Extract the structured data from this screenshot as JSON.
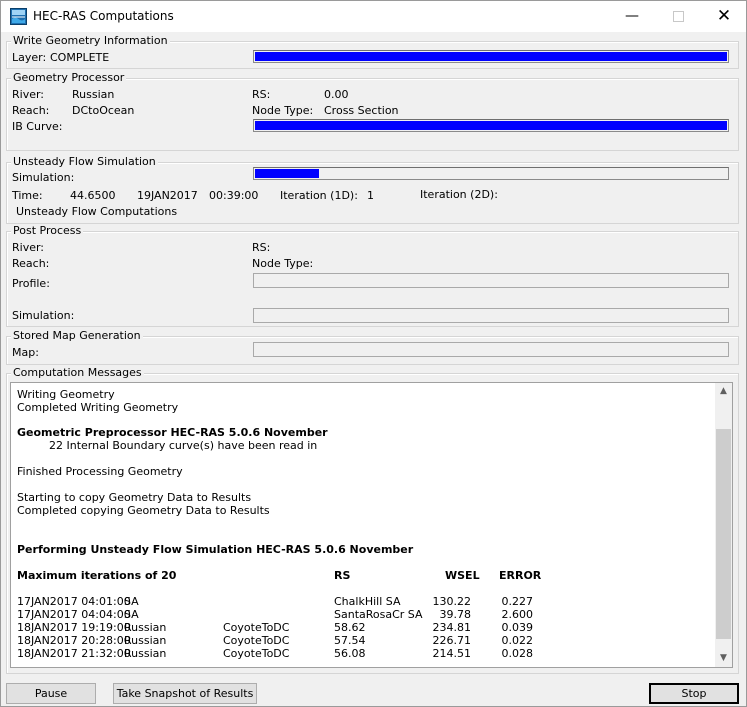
{
  "window": {
    "title": "HEC-RAS Computations",
    "minimize_icon": "minimize-icon",
    "maximize_icon": "maximize-icon",
    "close_icon": "close-icon"
  },
  "write_geometry": {
    "title": "Write Geometry Information",
    "layer_label": "Layer:",
    "layer_value": "COMPLETE",
    "progress": 1.0
  },
  "geometry_processor": {
    "title": "Geometry Processor",
    "river_label": "River:",
    "river_value": "Russian",
    "rs_label": "RS:",
    "rs_value": "0.00",
    "reach_label": "Reach:",
    "reach_value": "DCtoOcean",
    "node_type_label": "Node Type:",
    "node_type_value": "Cross Section",
    "ib_curve_label": "IB Curve:",
    "progress": 1.0
  },
  "unsteady": {
    "title": "Unsteady Flow Simulation",
    "simulation_label": "Simulation:",
    "progress": 0.14,
    "time_label": "Time:",
    "time_value": "44.6500",
    "date_value": "19JAN2017",
    "clock_value": "00:39:00",
    "iter1d_label": "Iteration (1D):",
    "iter1d_value": "1",
    "iter2d_label": "Iteration (2D):",
    "status": "Unsteady Flow Computations"
  },
  "post_process": {
    "title": "Post Process",
    "river_label": "River:",
    "rs_label": "RS:",
    "reach_label": "Reach:",
    "node_type_label": "Node Type:",
    "profile_label": "Profile:",
    "simulation_label": "Simulation:"
  },
  "stored_map": {
    "title": "Stored Map Generation",
    "map_label": "Map:"
  },
  "messages": {
    "title": "Computation Messages",
    "line1": "Writing Geometry",
    "line2": "Completed Writing Geometry",
    "geo_header": "Geometric Preprocessor HEC-RAS 5.0.6 November",
    "ib_read": "22 Internal Boundary curve(s) have been read in",
    "finished": "Finished Processing Geometry",
    "copy_start": "Starting to copy Geometry Data to Results",
    "copy_done": "Completed copying Geometry Data to Results",
    "unsteady_header": "Performing Unsteady Flow Simulation  HEC-RAS 5.0.6 November",
    "table_head": {
      "iterations": "Maximum iterations of 20",
      "rs": "RS",
      "wsel": "WSEL",
      "error": "ERROR"
    },
    "rows": [
      {
        "date": "17JAN2017 04:01:00",
        "river": "SA",
        "reach": "",
        "rs": "ChalkHill SA",
        "wsel": "130.22",
        "error": "0.227"
      },
      {
        "date": "17JAN2017 04:04:00",
        "river": "SA",
        "reach": "",
        "rs": "SantaRosaCr SA",
        "wsel": "39.78",
        "error": "2.600"
      },
      {
        "date": "18JAN2017 19:19:00",
        "river": "Russian",
        "reach": "CoyoteToDC",
        "rs": "58.62",
        "wsel": "234.81",
        "error": "0.039"
      },
      {
        "date": "18JAN2017 20:28:00",
        "river": "Russian",
        "reach": "CoyoteToDC",
        "rs": "57.54",
        "wsel": "226.71",
        "error": "0.022"
      },
      {
        "date": "18JAN2017 21:32:00",
        "river": "Russian",
        "reach": "CoyoteToDC",
        "rs": "56.08",
        "wsel": "214.51",
        "error": "0.028"
      }
    ]
  },
  "buttons": {
    "pause": "Pause",
    "snapshot": "Take Snapshot of Results",
    "stop": "Stop"
  }
}
